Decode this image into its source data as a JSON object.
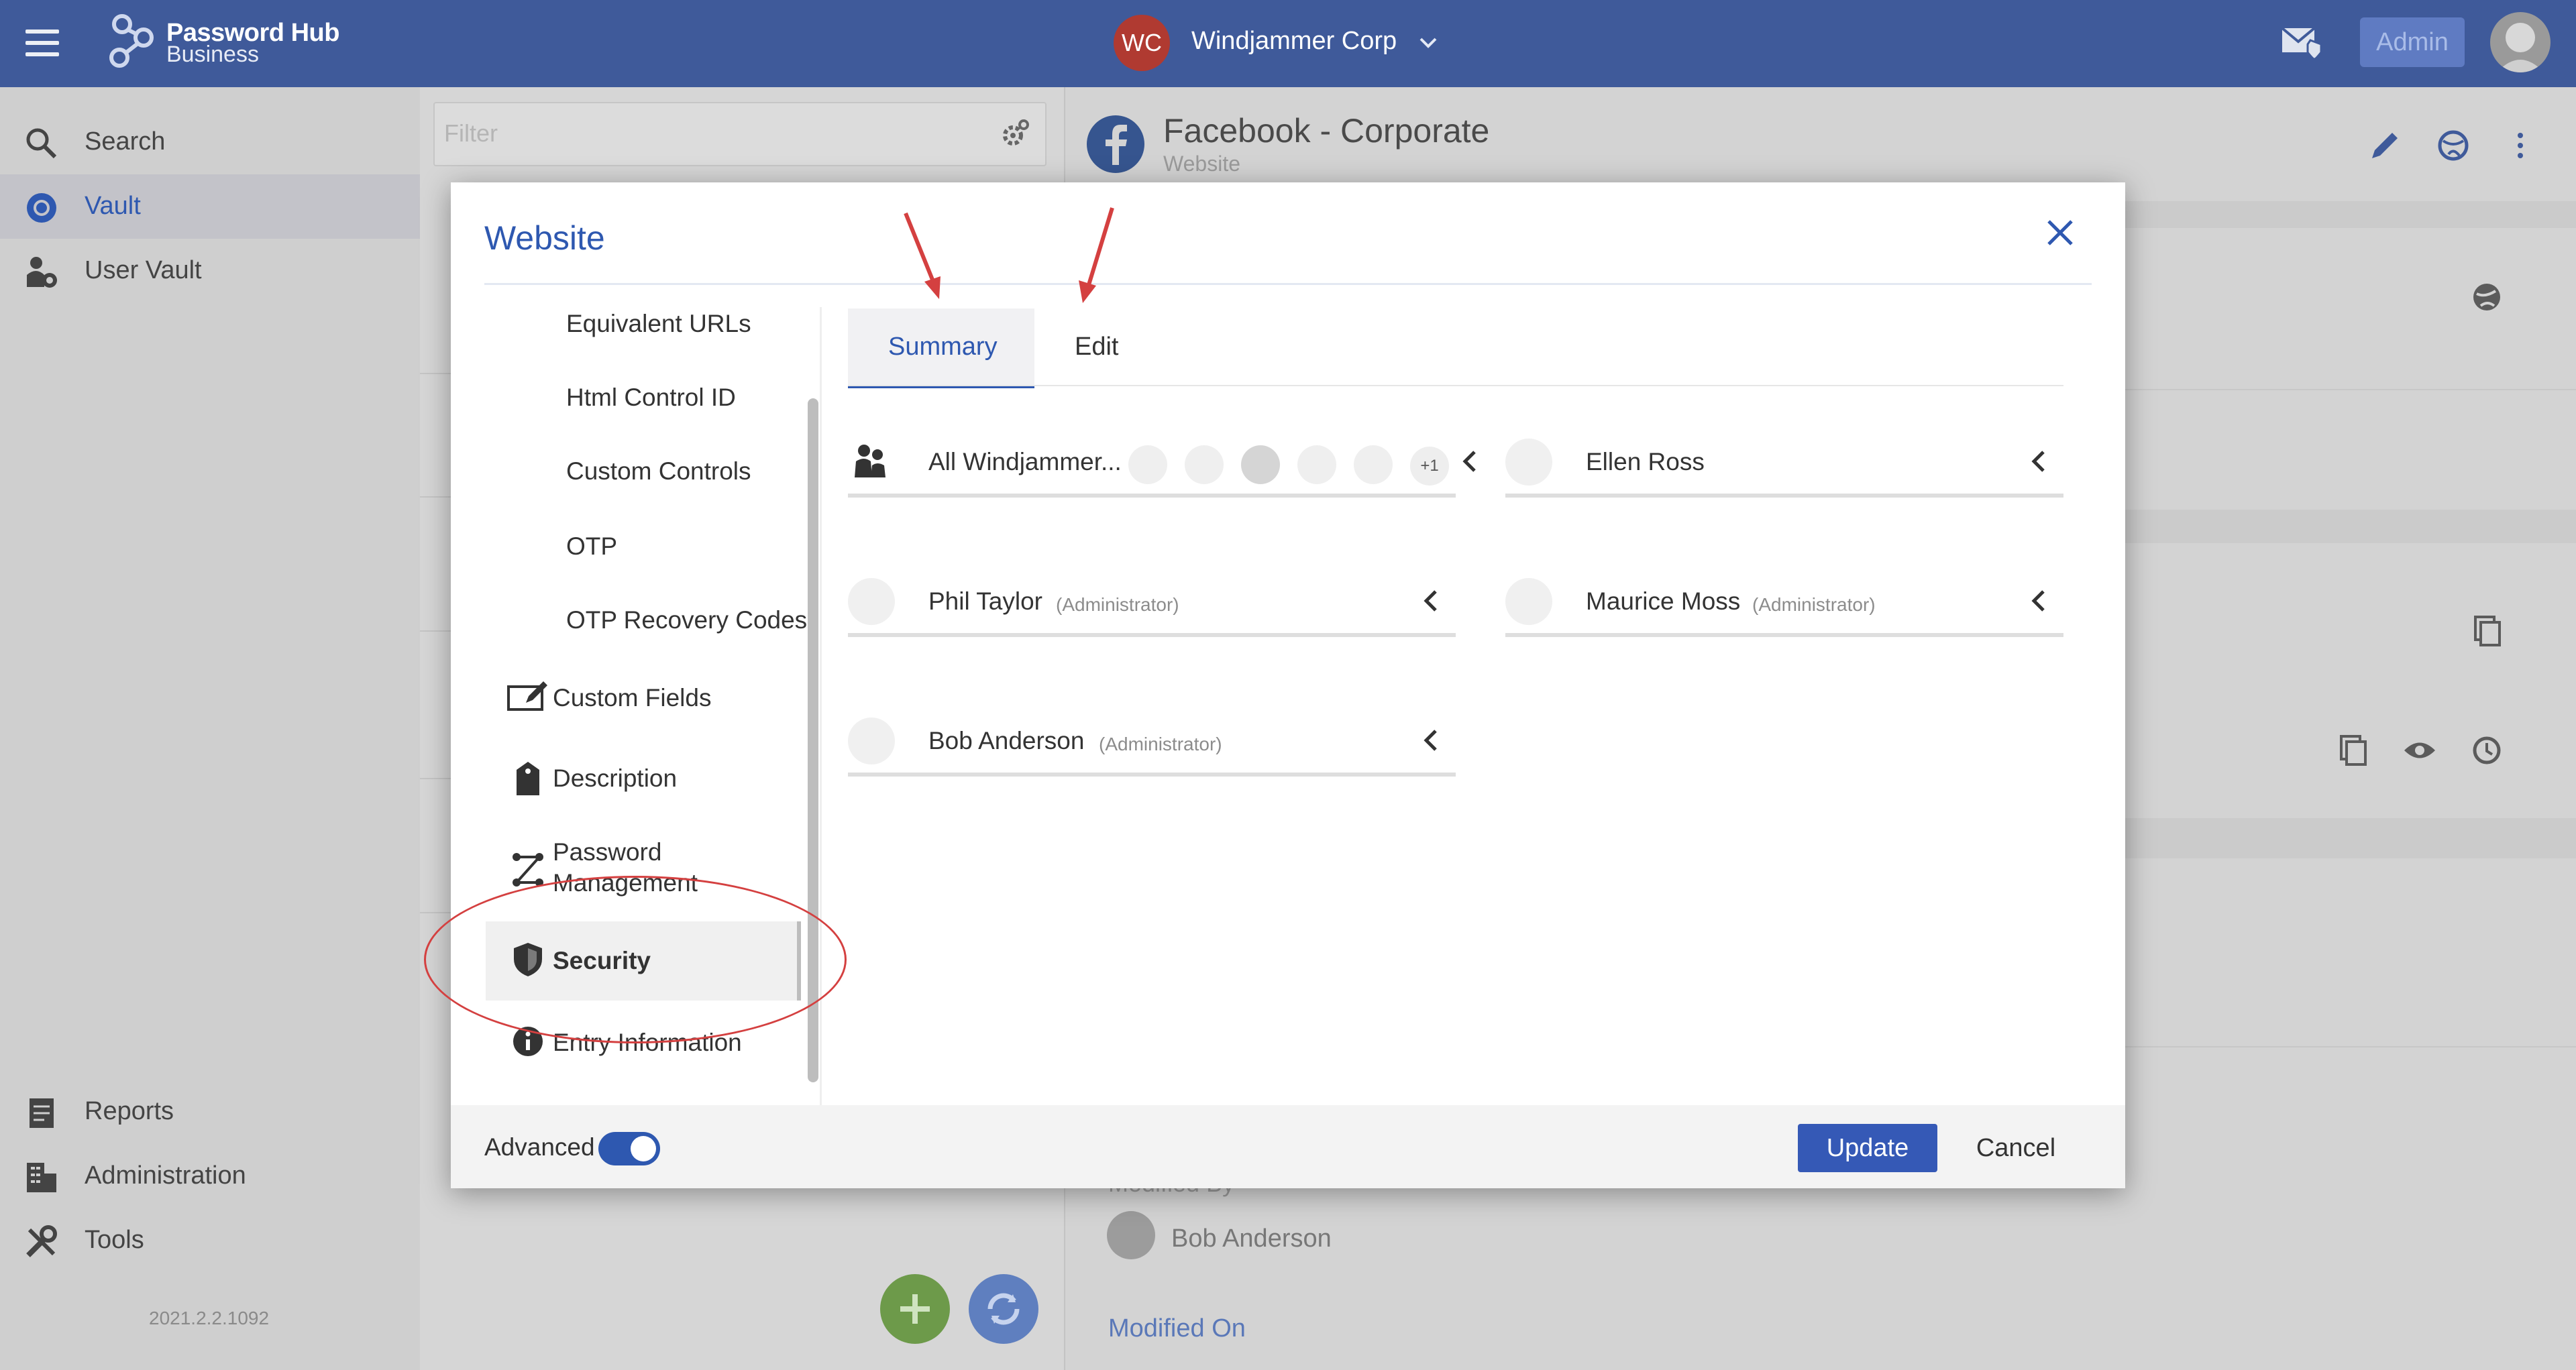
{
  "topbar": {
    "brand_title": "Password Hub",
    "brand_sub": "Business",
    "org_initials": "WC",
    "org_name": "Windjammer Corp",
    "admin_label": "Admin"
  },
  "sidebar": {
    "items": [
      {
        "label": "Search",
        "icon": "search-icon"
      },
      {
        "label": "Vault",
        "icon": "vault-icon"
      },
      {
        "label": "User Vault",
        "icon": "user-vault-icon"
      },
      {
        "label": "Reports",
        "icon": "reports-icon"
      },
      {
        "label": "Administration",
        "icon": "administration-icon"
      },
      {
        "label": "Tools",
        "icon": "tools-icon"
      }
    ],
    "version": "2021.2.2.1092"
  },
  "list": {
    "filter_placeholder": "Filter"
  },
  "detail": {
    "title": "Facebook - Corporate",
    "type": "Website",
    "modified_by_label": "Modified By",
    "modified_by": "Bob Anderson",
    "modified_on_label": "Modified On"
  },
  "modal": {
    "title": "Website",
    "nav": [
      {
        "label": "Equivalent URLs"
      },
      {
        "label": "Html Control ID"
      },
      {
        "label": "Custom Controls"
      },
      {
        "label": "OTP"
      },
      {
        "label": "OTP Recovery Codes"
      },
      {
        "label": "Custom Fields",
        "icon": "custom-fields-icon"
      },
      {
        "label": "Description",
        "icon": "tag-icon"
      },
      {
        "label": "Password",
        "label2": "Management",
        "icon": "password-management-icon"
      },
      {
        "label": "Security",
        "icon": "shield-icon",
        "selected": true
      },
      {
        "label": "Entry Information",
        "icon": "info-icon"
      }
    ],
    "tabs": [
      {
        "label": "Summary",
        "active": true
      },
      {
        "label": "Edit",
        "active": false
      }
    ],
    "permissions": [
      {
        "name": "All Windjammer...",
        "role": "",
        "extra": "+1"
      },
      {
        "name": "Ellen Ross",
        "role": ""
      },
      {
        "name": "Phil Taylor",
        "role": "(Administrator)"
      },
      {
        "name": "Maurice Moss",
        "role": "(Administrator)"
      },
      {
        "name": "Bob Anderson",
        "role": "(Administrator)"
      }
    ],
    "advanced_label": "Advanced",
    "advanced_on": true,
    "update_label": "Update",
    "cancel_label": "Cancel"
  },
  "colors": {
    "topbar": "#3f5a9a",
    "accent": "#2e58b0",
    "annotation": "#d44040"
  }
}
